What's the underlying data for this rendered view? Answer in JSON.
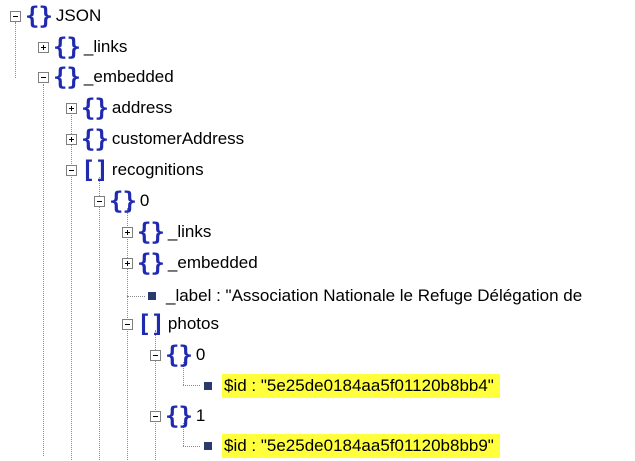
{
  "tree": {
    "root": {
      "label": "JSON"
    },
    "links": {
      "label": "_links"
    },
    "embedded": {
      "label": "_embedded"
    },
    "address": {
      "label": "address"
    },
    "customerAddress": {
      "label": "customerAddress"
    },
    "recognitions": {
      "label": "recognitions"
    },
    "rec0": {
      "label": "0"
    },
    "rec0_links": {
      "label": "_links"
    },
    "rec0_embedded": {
      "label": "_embedded"
    },
    "rec0_label": {
      "label": "_label : \"Association Nationale le Refuge Délégation de"
    },
    "photos": {
      "label": "photos"
    },
    "photo0": {
      "label": "0"
    },
    "photo0_id": {
      "label": "$id : \"5e25de0184aa5f01120b8bb4\""
    },
    "photo1": {
      "label": "1"
    },
    "photo1_id": {
      "label": "$id : \"5e25de0184aa5f01120b8bb9\""
    }
  },
  "colors": {
    "brace": "#1f2ab0",
    "highlight": "#ffff3c",
    "leaf": "#2a3a6a"
  }
}
